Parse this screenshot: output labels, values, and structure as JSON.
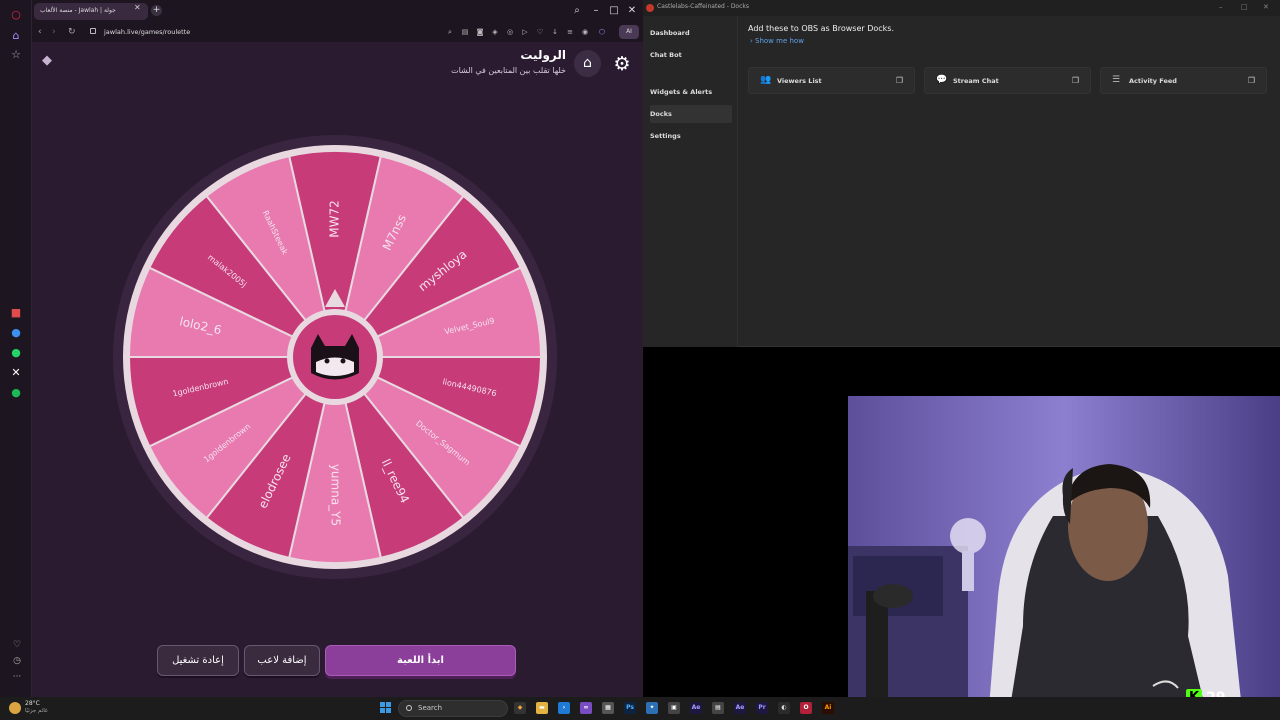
{
  "browser": {
    "tab_title": "جولة | Jawlah - منصة الألعاب",
    "url": "jawlah.live/games/roulette",
    "ai_label": "AI"
  },
  "page": {
    "title": "الروليت",
    "subtitle": "خلها تقلب بين المتابعين في الشات"
  },
  "wheel": {
    "segments": [
      "MW72",
      "M7nss",
      "myshloya",
      "Velvet_Soul9",
      "lion44490876",
      "Doctor_Sagmum",
      "ll_ree94",
      "yumna_Y5",
      "elodrosee",
      "1goldenbrown",
      "1goldenbrown",
      "lolo2_6",
      "malak2005j",
      "RaahSteeak"
    ],
    "colors": {
      "dark": "#c73b79",
      "light": "#e87ab0",
      "rim": "#e8d9e0",
      "outer": "#3a2540"
    }
  },
  "actions": {
    "reset_label": "إعادة تشغيل",
    "add_player_label": "إضافة لاعب",
    "start_label": "ابدأ اللعبة"
  },
  "docks": {
    "window_title": "Castlelabs-Caffeinated - Docks",
    "nav": [
      "Dashboard",
      "Chat Bot",
      "Widgets & Alerts",
      "Docks",
      "Settings"
    ],
    "heading": "Add these to OBS as Browser Docks.",
    "show_me_how": "› Show me how",
    "cards": [
      "Viewers List",
      "Stream Chat",
      "Activity Feed"
    ]
  },
  "stream": {
    "viewer_count": "29"
  },
  "taskbar": {
    "temperature": "28°C",
    "weather_desc": "غائم جزئيًا",
    "search_placeholder": "Search"
  }
}
